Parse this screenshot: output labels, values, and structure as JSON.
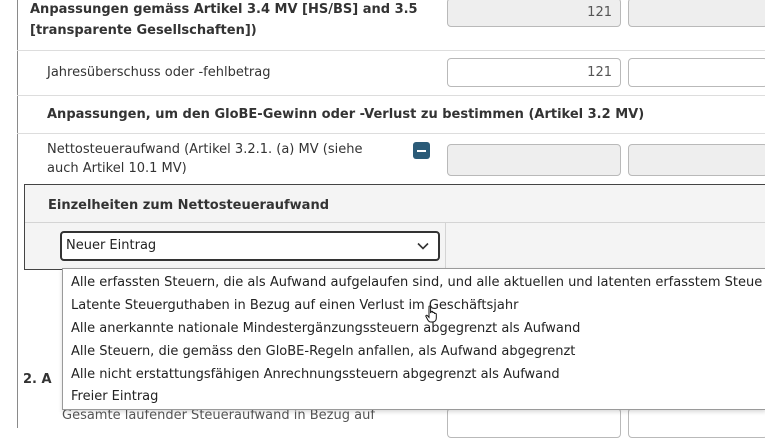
{
  "rows": {
    "adjustments_title_line1": "Anpassungen gemäss Artikel 3.4 MV [HS/BS] and 3.5",
    "adjustments_title_line2": "[transparente Gesellschaften])",
    "adjustments_value": "121",
    "annual_result_label": "Jahresüberschuss oder -fehlbetrag",
    "annual_result_value": "121",
    "globe_section_title": "Anpassungen, um den GloBE-Gewinn oder -Verlust zu bestimmen (Artikel 3.2 MV)",
    "net_tax_label_line1": "Nettosteueraufwand (Artikel 3.2.1. (a) MV (siehe",
    "net_tax_label_line2": "auch Artikel 10.1 MV)",
    "section2_prefix": "2. A",
    "bottom_partial_label": "Gesamte laufender Steueraufwand in Bezug auf"
  },
  "details_panel": {
    "title": "Einzelheiten zum Nettosteueraufwand",
    "select_value": "Neuer Eintrag"
  },
  "dropdown": {
    "options": [
      "Alle erfassten Steuern, die als Aufwand aufgelaufen sind, und alle aktuellen und latenten erfasstem Steue",
      "Latente Steuerguthaben in Bezug auf einen Verlust im Geschäftsjahr",
      "Alle anerkannte nationale Mindestergänzungssteuern abgegrenzt als Aufwand",
      "Alle Steuern, die gemäss den GloBE-Regeln anfallen, als Aufwand abgegrenzt",
      "Alle nicht erstattungsfähigen Anrechnungssteuern abgegrenzt als Aufwand",
      "Freier Eintrag"
    ]
  },
  "colors": {
    "accent_button": "#2b5b78",
    "panel_bg": "#f4f4f4",
    "input_gray": "#eeeeee"
  },
  "icons": {
    "collapse": "minus-icon",
    "select": "chevron-down-icon",
    "cursor": "hand-pointer-icon"
  }
}
